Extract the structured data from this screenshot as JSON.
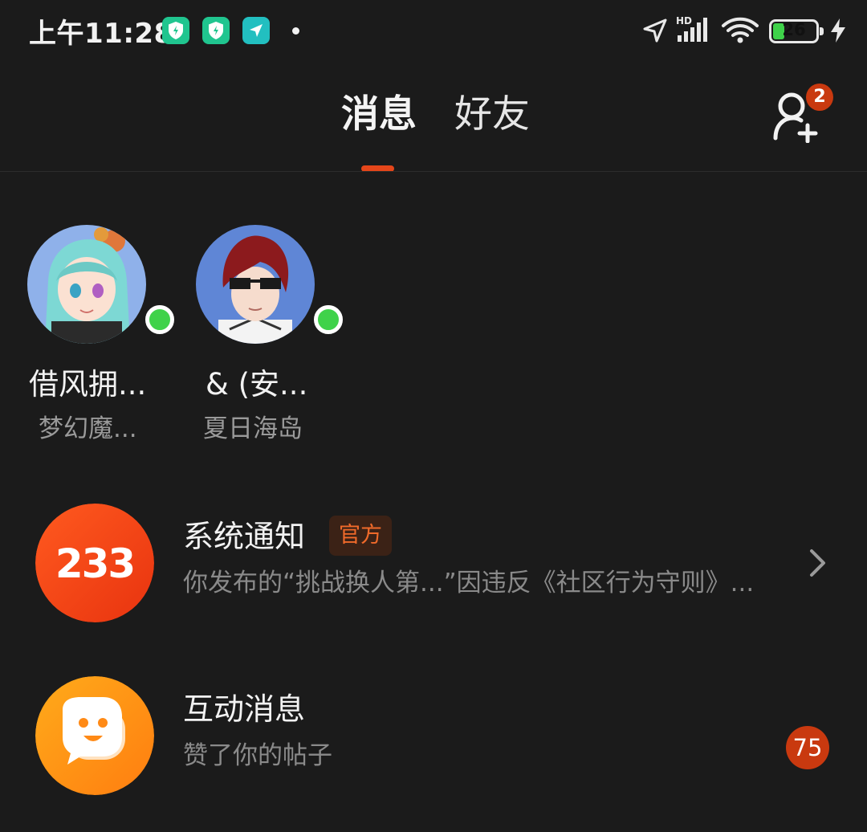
{
  "status_bar": {
    "time": "上午11:28",
    "network_label": "HD",
    "battery_level": "26",
    "battery_fraction": 0.26
  },
  "header": {
    "tabs": [
      {
        "label": "消息",
        "active": true
      },
      {
        "label": "好友",
        "active": false
      }
    ],
    "friend_request_count": "2"
  },
  "online_friends": [
    {
      "name": "借风拥...",
      "game": "梦幻魔...",
      "online": true
    },
    {
      "name": "& (安...",
      "game": "夏日海岛",
      "online": true
    }
  ],
  "conversations": [
    {
      "title": "系统通知",
      "tag": "官方",
      "preview": "你发布的“挑战换人第...”因违反《社区行为守则》...",
      "avatar_text": "233"
    },
    {
      "title": "互动消息",
      "preview": "赞了你的帖子",
      "unread_count": "75"
    }
  ],
  "colors": {
    "background": "#1b1b1b",
    "accent": "#e5461a",
    "badge": "#c9390f",
    "online": "#3fd24a",
    "official_tag_text": "#f06a2a",
    "secondary_text": "#8a8a8a"
  }
}
